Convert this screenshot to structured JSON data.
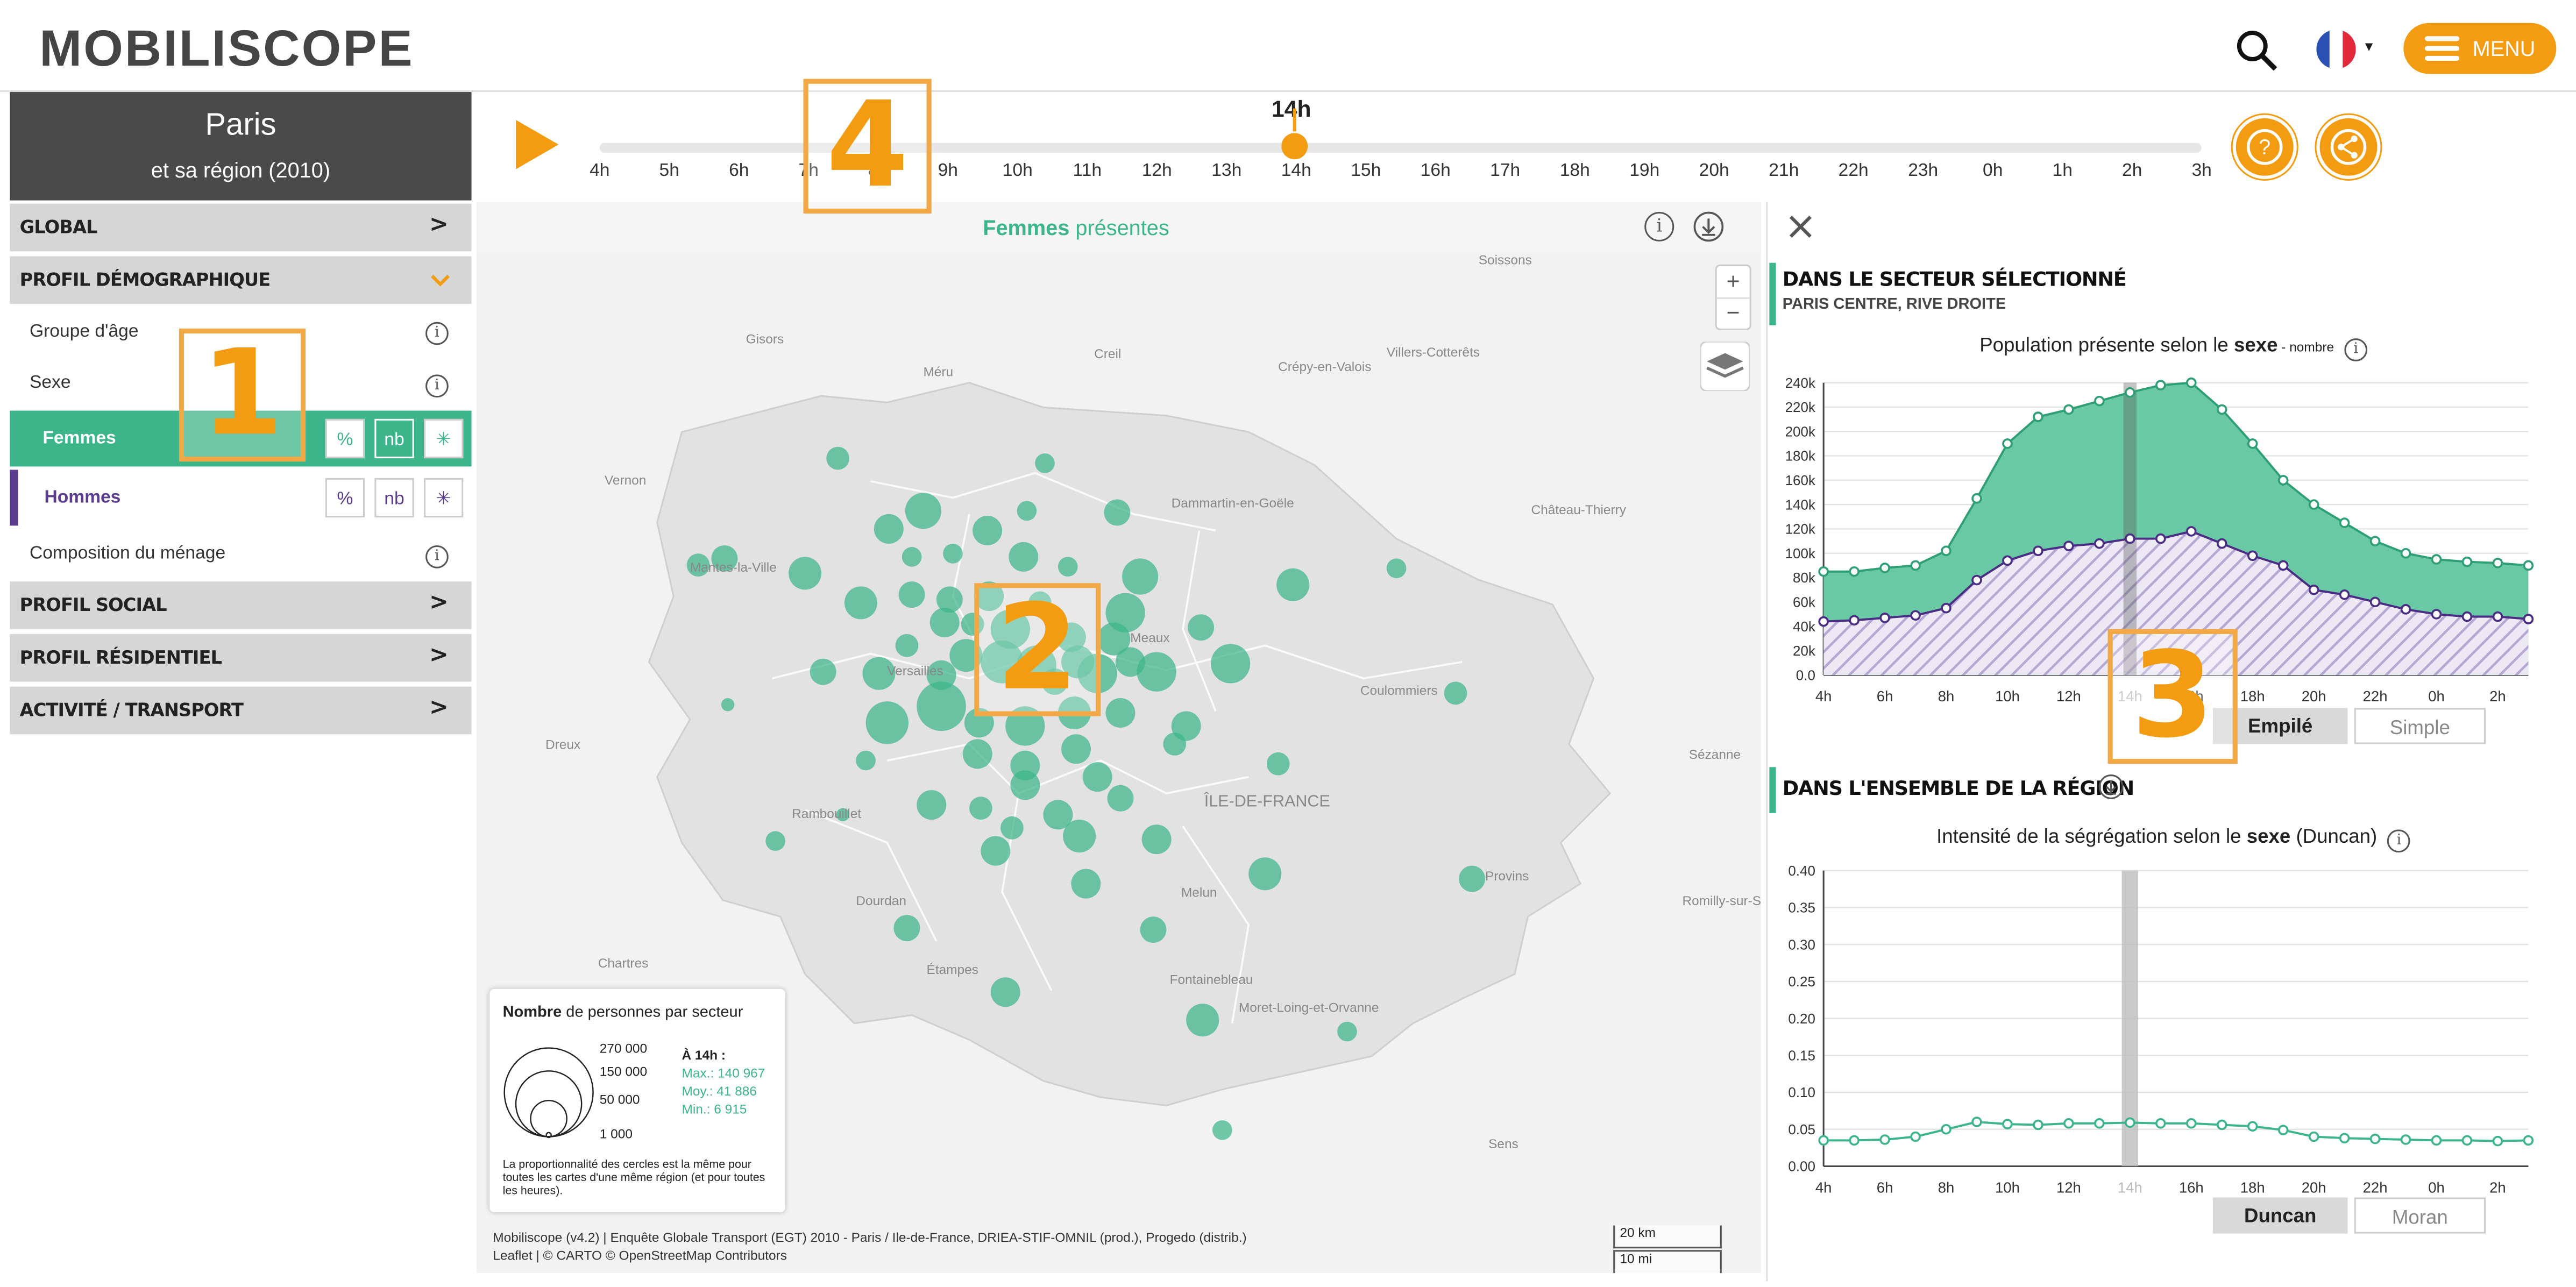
{
  "header": {
    "logo": "MOBILISCOPE",
    "search_icon": "search-icon",
    "language_flag": "flag-fr-icon",
    "menu_label": "MENU"
  },
  "sidebar": {
    "city": "Paris",
    "region": "et sa région (2010)",
    "sections": [
      {
        "label": "Global"
      },
      {
        "label": "Profil démographique"
      },
      {
        "label": "Profil social"
      },
      {
        "label": "Profil résidentiel"
      },
      {
        "label": "Activité / Transport"
      }
    ],
    "subitems": {
      "age": "Groupe d'âge",
      "sexe": "Sexe",
      "femmes": "Femmes",
      "hommes": "Hommes",
      "menage": "Composition du ménage"
    },
    "mode_buttons": [
      "%",
      "nb",
      "✳"
    ]
  },
  "timeline": {
    "current": "14h",
    "hours": [
      "4h",
      "5h",
      "6h",
      "7h",
      "8h",
      "9h",
      "10h",
      "11h",
      "12h",
      "13h",
      "14h",
      "15h",
      "16h",
      "17h",
      "18h",
      "19h",
      "20h",
      "21h",
      "22h",
      "23h",
      "0h",
      "1h",
      "2h",
      "3h"
    ]
  },
  "map": {
    "title_bold": "Femmes",
    "title_rest": " présentes",
    "zoom_in": "+",
    "zoom_out": "−",
    "places": [
      {
        "name": "Soissons"
      },
      {
        "name": "Creil"
      },
      {
        "name": "Gisors"
      },
      {
        "name": "Méru"
      },
      {
        "name": "Crépy-en-Valois"
      },
      {
        "name": "Villers-Cotterêts"
      },
      {
        "name": "Vernon"
      },
      {
        "name": "Dammartin-en-Goële"
      },
      {
        "name": "Château-Thierry"
      },
      {
        "name": "Dreux"
      },
      {
        "name": "Coulommiers"
      },
      {
        "name": "Sézanne"
      },
      {
        "name": "Rambouillet"
      },
      {
        "name": "ÎLE-DE-FRANCE"
      },
      {
        "name": "Provins"
      },
      {
        "name": "Dourdan"
      },
      {
        "name": "Melun"
      },
      {
        "name": "Romilly-sur-Seine"
      },
      {
        "name": "Chartres"
      },
      {
        "name": "Étampes"
      },
      {
        "name": "Fontainebleau"
      },
      {
        "name": "Moret-Loing-et-Orvanne"
      },
      {
        "name": "Sens"
      },
      {
        "name": "Mantes-la-Ville"
      },
      {
        "name": "Versailles"
      },
      {
        "name": "Meaux"
      }
    ],
    "legend": {
      "title_bold": "Nombre",
      "title_rest": " de personnes par secteur",
      "sizes": [
        "270 000",
        "150 000",
        "50 000",
        "1 000"
      ],
      "at": "À 14h :",
      "max": "Max.: 140 967",
      "moy": "Moy.: 41 886",
      "min": "Min.: 6 915",
      "note": "La proportionnalité des cercles est la même pour toutes les cartes d'une même région (et pour toutes les heures)."
    },
    "attribution_1": "Mobiliscope (v4.2) | Enquête Globale Transport (EGT) 2010 - Paris / Ile-de-France, DRIEA-STIF-OMNIL (prod.), Progedo (distrib.)",
    "attribution_2": "Leaflet | © CARTO © OpenStreetMap Contributors",
    "scale_km": "20 km",
    "scale_mi": "10 mi"
  },
  "panel": {
    "sector_heading": "DANS LE SECTEUR SÉLECTIONNÉ",
    "sector_name": "PARIS CENTRE, RIVE DROITE",
    "chart1_title_a": "Population présente selon le ",
    "chart1_title_b": "sexe",
    "chart1_title_c": " - nombre",
    "tab_empile": "Empilé",
    "tab_simple": "Simple",
    "region_heading": "DANS L'ENSEMBLE DE LA RÉGION",
    "chart2_title_a": "Intensité de la ségrégation selon le ",
    "chart2_title_b": "sexe",
    "chart2_title_c": " (Duncan)",
    "tab_duncan": "Duncan",
    "tab_moran": "Moran"
  },
  "overlays": [
    "1",
    "2",
    "3",
    "4"
  ],
  "colors": {
    "accent": "#f39c12",
    "femmes": "#3cb58a",
    "hommes": "#5b3c8e"
  },
  "chart_data": [
    {
      "type": "area",
      "title": "Population présente selon le sexe - nombre",
      "x": [
        "4h",
        "5h",
        "6h",
        "7h",
        "8h",
        "9h",
        "10h",
        "11h",
        "12h",
        "13h",
        "14h",
        "15h",
        "16h",
        "17h",
        "18h",
        "19h",
        "20h",
        "21h",
        "22h",
        "23h",
        "0h",
        "1h",
        "2h",
        "3h"
      ],
      "xticks": [
        "4h",
        "6h",
        "8h",
        "10h",
        "12h",
        "14h",
        "16h",
        "18h",
        "20h",
        "22h",
        "0h",
        "2h"
      ],
      "yticks": [
        "0.0",
        "20k",
        "40k",
        "60k",
        "80k",
        "100k",
        "120k",
        "140k",
        "160k",
        "180k",
        "200k",
        "220k",
        "240k"
      ],
      "ylim": [
        0,
        240000
      ],
      "series": [
        {
          "values": [
            85000,
            85000,
            88000,
            90000,
            102000,
            145000,
            190000,
            212000,
            218000,
            225000,
            232000,
            238000,
            240000,
            218000,
            190000,
            160000,
            140000,
            125000,
            110000,
            100000,
            95000,
            93000,
            92000,
            90000
          ]
        },
        {
          "values": [
            44000,
            45000,
            47000,
            49000,
            55000,
            78000,
            94000,
            102000,
            106000,
            108000,
            112000,
            112000,
            118000,
            108000,
            98000,
            90000,
            70000,
            66000,
            60000,
            54000,
            50000,
            48000,
            48000,
            46000
          ]
        }
      ],
      "highlight": "14h"
    },
    {
      "type": "line",
      "title": "Intensité de la ségrégation selon le sexe (Duncan)",
      "x": [
        "4h",
        "5h",
        "6h",
        "7h",
        "8h",
        "9h",
        "10h",
        "11h",
        "12h",
        "13h",
        "14h",
        "15h",
        "16h",
        "17h",
        "18h",
        "19h",
        "20h",
        "21h",
        "22h",
        "23h",
        "0h",
        "1h",
        "2h",
        "3h"
      ],
      "xticks": [
        "4h",
        "6h",
        "8h",
        "10h",
        "12h",
        "14h",
        "16h",
        "18h",
        "20h",
        "22h",
        "0h",
        "2h"
      ],
      "yticks": [
        "0.00",
        "0.05",
        "0.10",
        "0.15",
        "0.20",
        "0.25",
        "0.30",
        "0.35",
        "0.40"
      ],
      "ylim": [
        0,
        0.4
      ],
      "series": [
        {
          "values": [
            0.035,
            0.035,
            0.036,
            0.04,
            0.05,
            0.06,
            0.057,
            0.056,
            0.058,
            0.058,
            0.059,
            0.058,
            0.058,
            0.056,
            0.054,
            0.049,
            0.04,
            0.038,
            0.037,
            0.036,
            0.035,
            0.035,
            0.034,
            0.035
          ]
        }
      ],
      "highlight": "14h"
    }
  ]
}
